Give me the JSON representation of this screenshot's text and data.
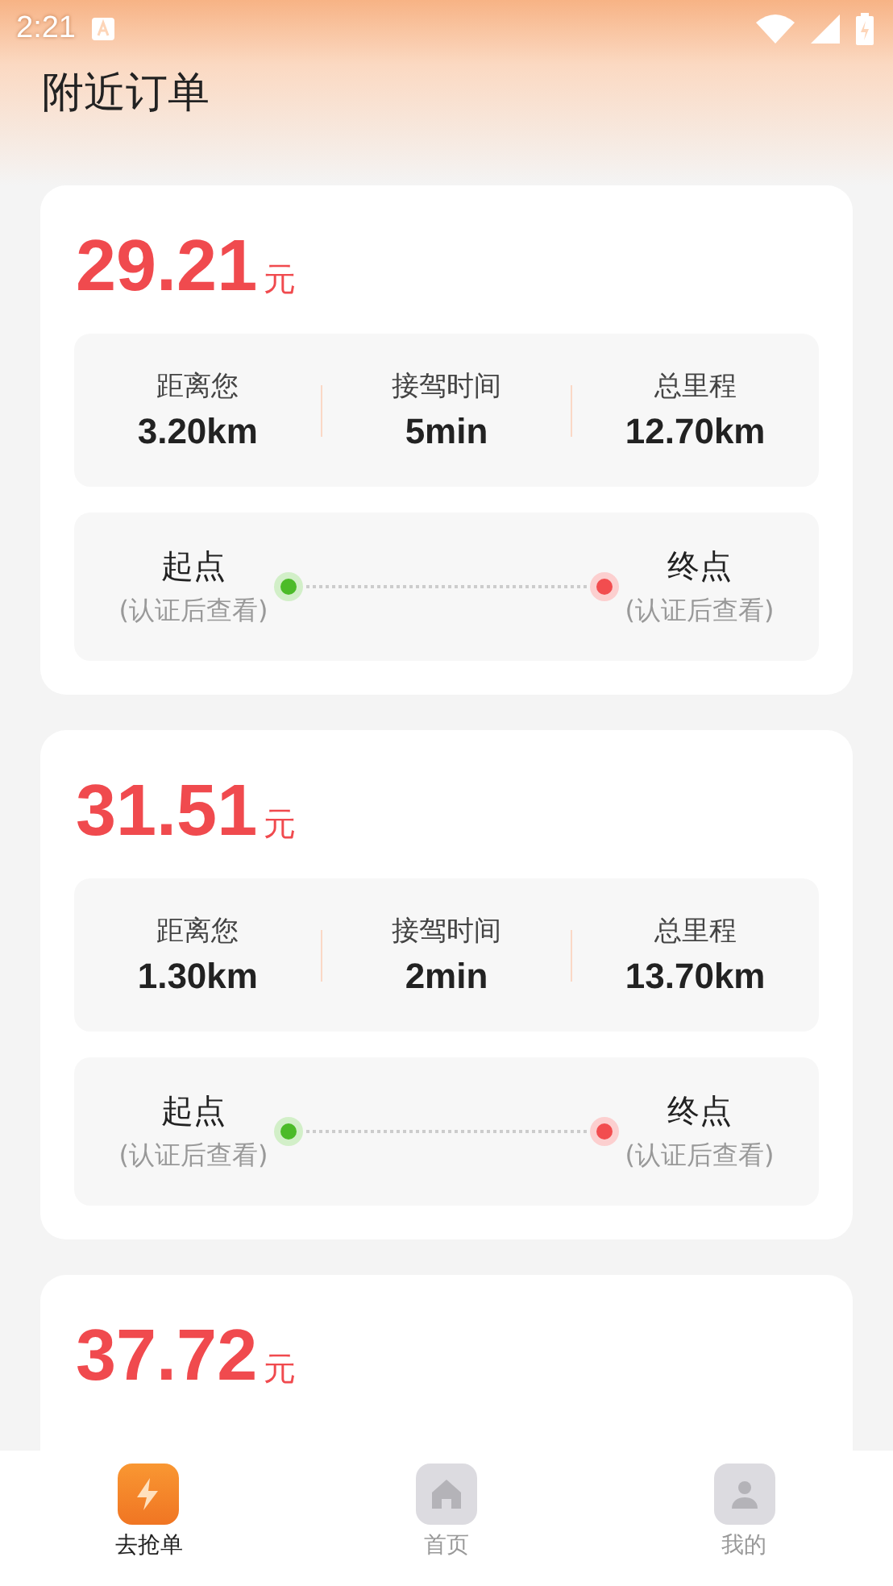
{
  "status_bar": {
    "time": "2:21"
  },
  "title": "附近订单",
  "orders": [
    {
      "price": "29.21",
      "unit": "元",
      "stats": [
        {
          "label": "距离您",
          "value": "3.20km"
        },
        {
          "label": "接驾时间",
          "value": "5min"
        },
        {
          "label": "总里程",
          "value": "12.70km"
        }
      ],
      "route": {
        "start": "起点",
        "start_note": "(认证后查看)",
        "end": "终点",
        "end_note": "(认证后查看)"
      }
    },
    {
      "price": "31.51",
      "unit": "元",
      "stats": [
        {
          "label": "距离您",
          "value": "1.30km"
        },
        {
          "label": "接驾时间",
          "value": "2min"
        },
        {
          "label": "总里程",
          "value": "13.70km"
        }
      ],
      "route": {
        "start": "起点",
        "start_note": "(认证后查看)",
        "end": "终点",
        "end_note": "(认证后查看)"
      }
    },
    {
      "price": "37.72",
      "unit": "元"
    }
  ],
  "tabs": [
    {
      "label": "去抢单",
      "kind": "bolt",
      "selected": true
    },
    {
      "label": "首页",
      "kind": "home",
      "selected": false
    },
    {
      "label": "我的",
      "kind": "person",
      "selected": false
    }
  ]
}
